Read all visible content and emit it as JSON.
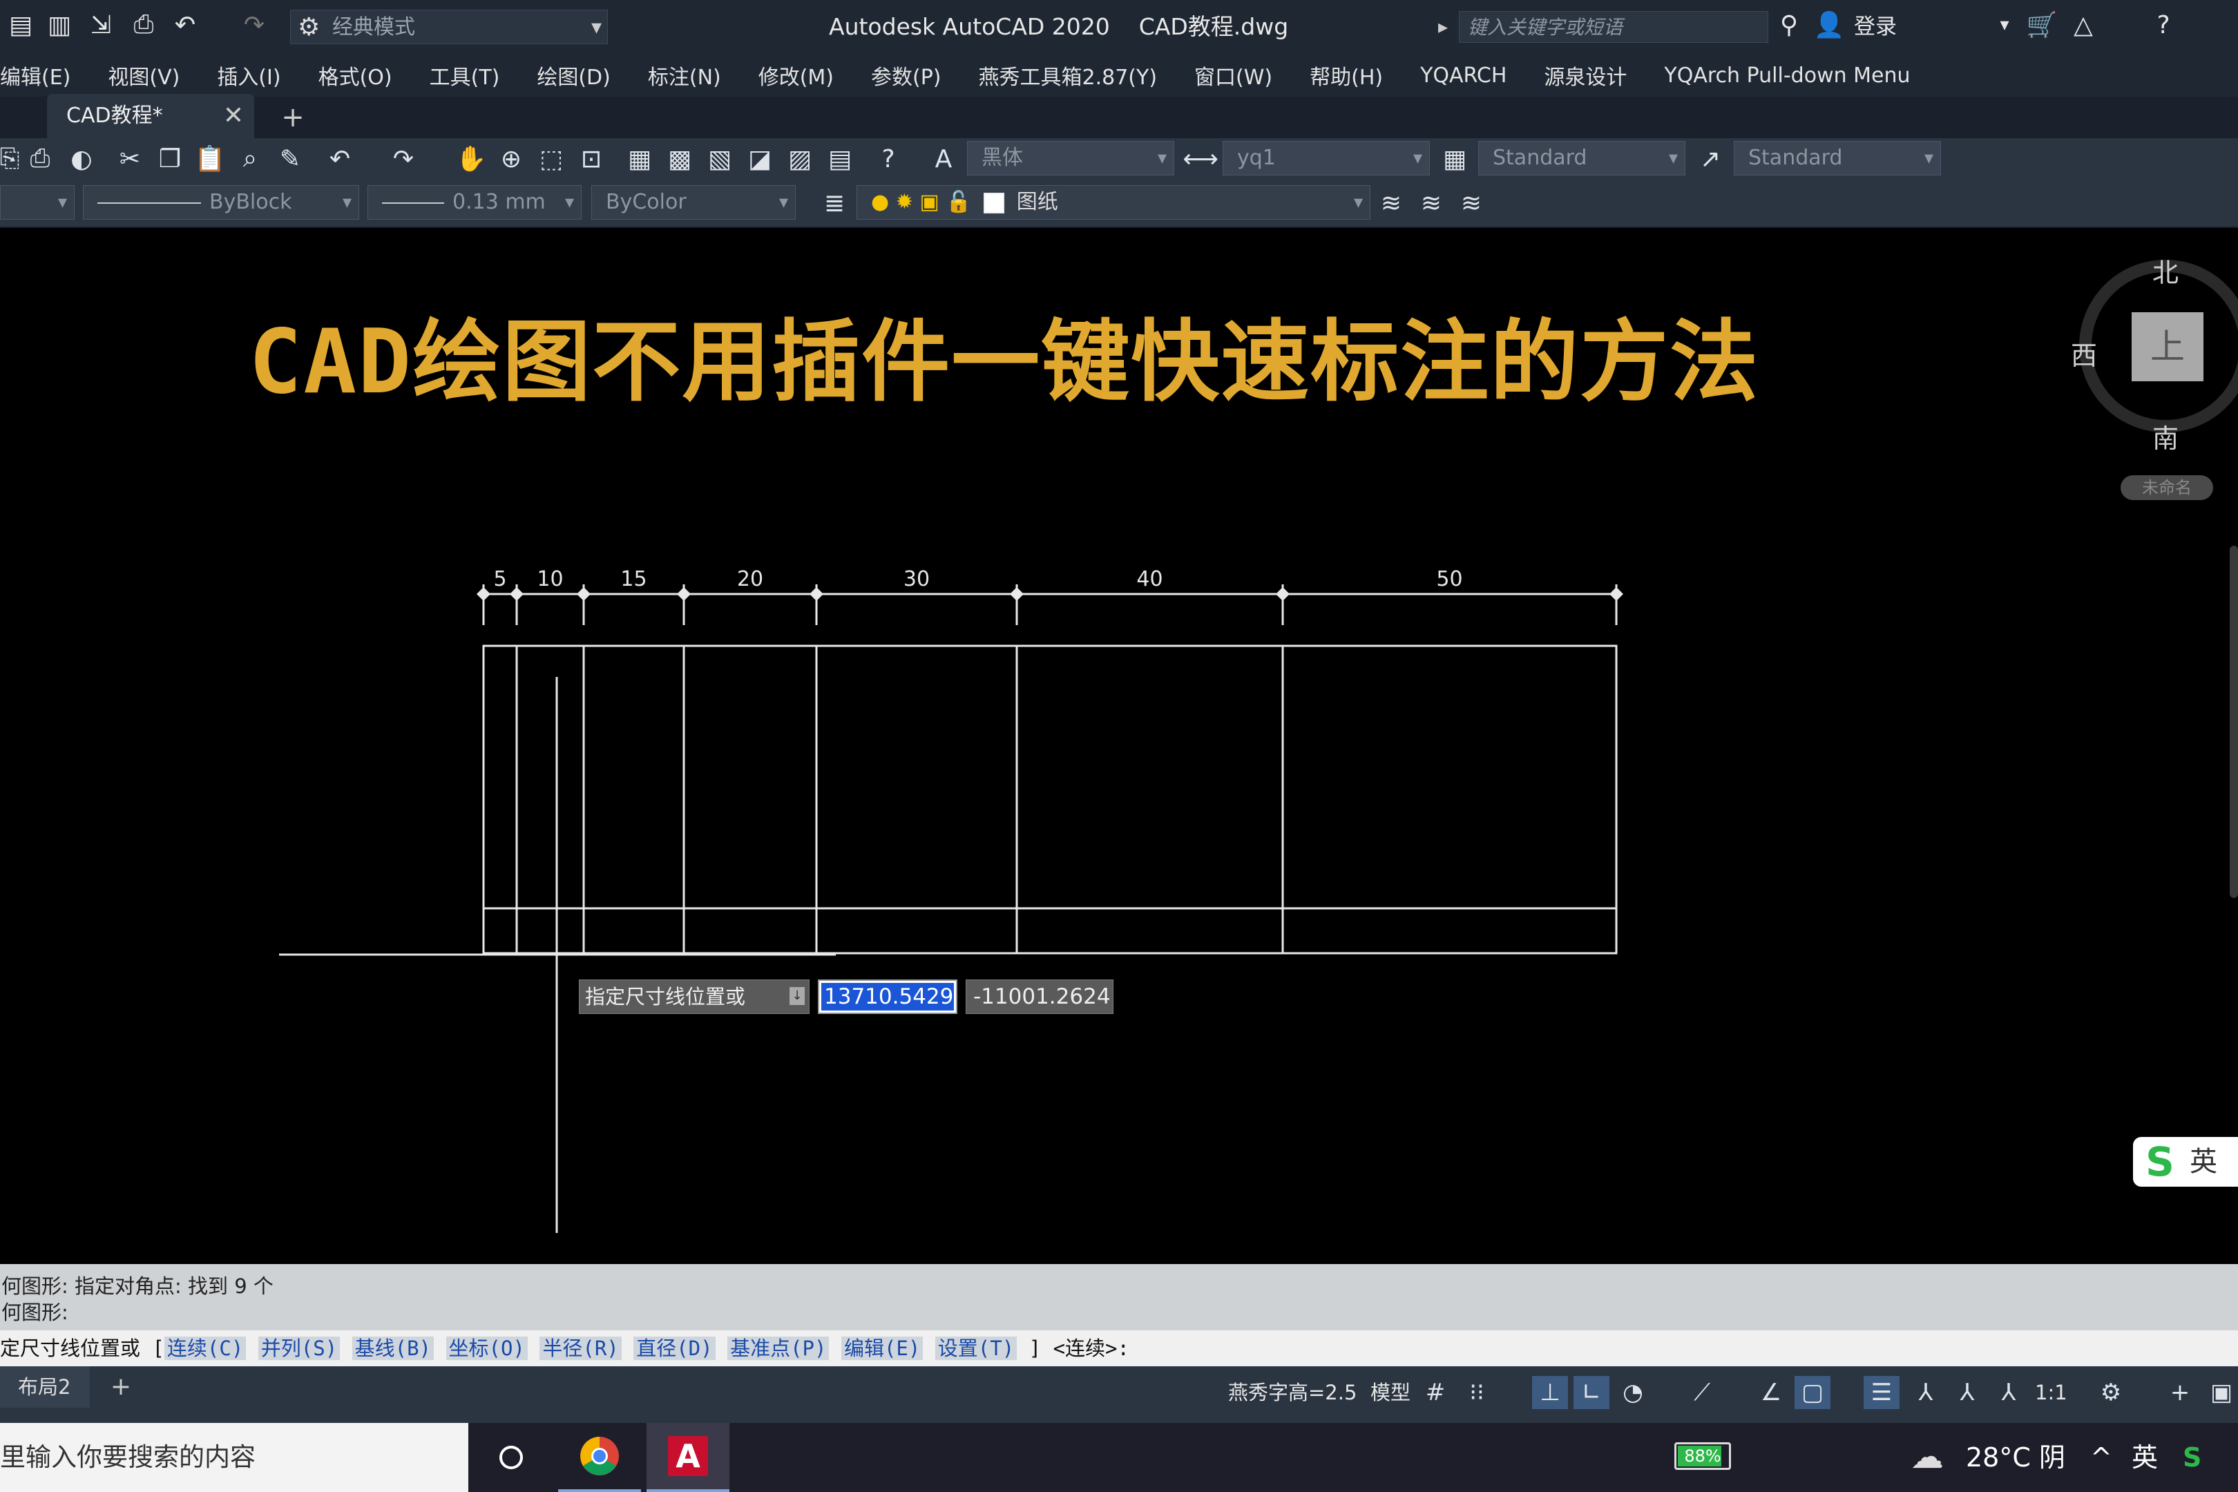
{
  "window": {
    "workspace": "经典模式",
    "app_title": "Autodesk AutoCAD 2020    CAD教程.dwg",
    "search_placeholder": "键入关键字或短语",
    "login": "登录"
  },
  "menu": [
    "编辑(E)",
    "视图(V)",
    "插入(I)",
    "格式(O)",
    "工具(T)",
    "绘图(D)",
    "标注(N)",
    "修改(M)",
    "参数(P)",
    "燕秀工具箱2.87(Y)",
    "窗口(W)",
    "帮助(H)",
    "YQARCH",
    "源泉设计",
    "YQArch Pull-down Menu"
  ],
  "tabs": {
    "doc_tab": "CAD教程*",
    "close": "✕",
    "add": "+"
  },
  "toolbar": {
    "text_style": "黑体",
    "dim_style": "yq1",
    "table_style": "Standard",
    "multileader_style": "Standard",
    "linetype": "ByBlock",
    "lineweight": "0.13 mm",
    "color": "ByColor",
    "layer": "图纸"
  },
  "drawing": {
    "title": "CAD绘图不用插件一键快速标注的方法",
    "dimension_labels": [
      "5",
      "10",
      "15",
      "20",
      "30",
      "40",
      "50"
    ]
  },
  "dynamic_input": {
    "prompt": "指定尺寸线位置或",
    "x_value": "13710.5429",
    "y_value": "-11001.2624"
  },
  "viewcube": {
    "north": "北",
    "west": "西",
    "south": "南",
    "face": "上",
    "wcs": "未命名"
  },
  "ime": {
    "label": "英"
  },
  "command": {
    "history": [
      "何图形: 指定对角点: 找到 9 个",
      "何图形:"
    ],
    "prompt_prefix": "定尺寸线位置或 [",
    "options": [
      "连续(C)",
      "并列(S)",
      "基线(B)",
      "坐标(O)",
      "半径(R)",
      "直径(D)",
      "基准点(P)",
      "编辑(E)",
      "设置(T)"
    ],
    "prompt_suffix": "] <连续>:"
  },
  "status": {
    "layout_tab": "布局2",
    "layout_add": "+",
    "text_height": "燕秀字高=2.5",
    "model": "模型",
    "scale": "1:1"
  },
  "taskbar": {
    "search_placeholder": "里输入你要搜索的内容",
    "battery": "88%",
    "battery_level": 0.88,
    "weather": "28°C 阴",
    "ime": "英"
  },
  "colors": {
    "title_gold": "#e0a82e",
    "ui_dark": "#2b3441",
    "accent_blue": "#1a56d6"
  }
}
